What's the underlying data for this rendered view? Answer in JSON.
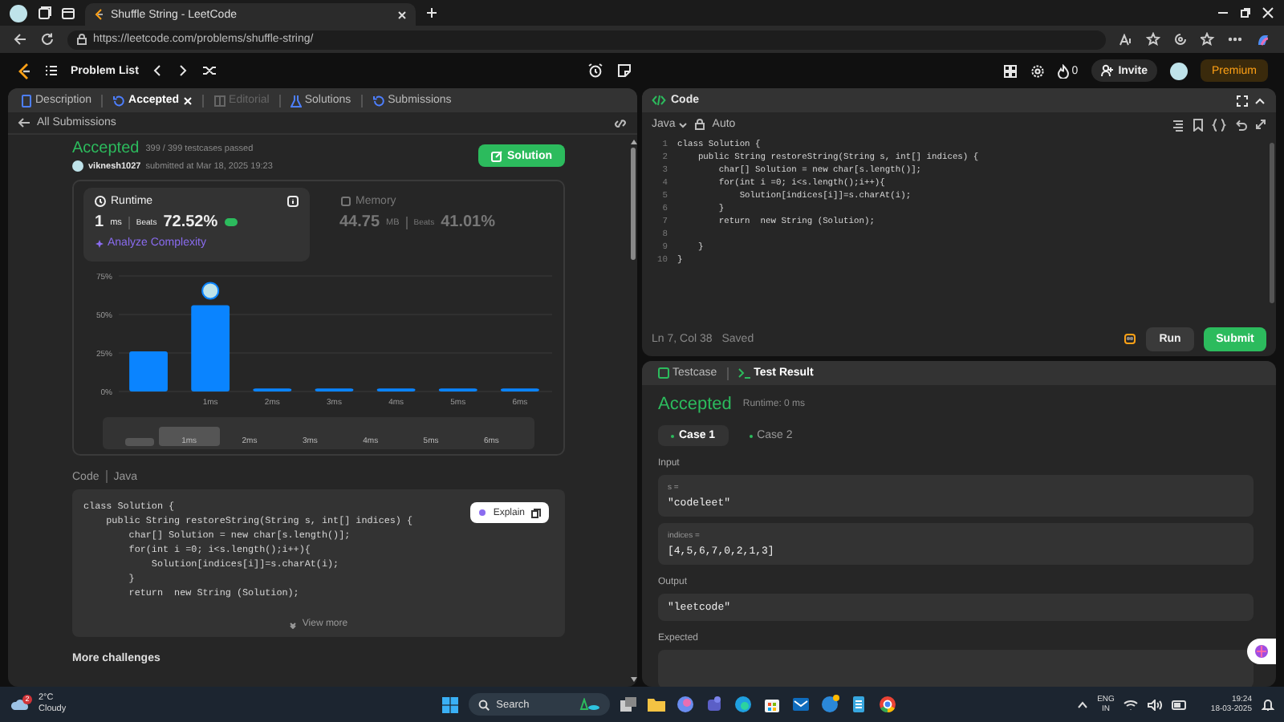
{
  "browser": {
    "tab_title": "Shuffle String - LeetCode",
    "url": "https://leetcode.com/problems/shuffle-string/"
  },
  "navbar": {
    "problem_list": "Problem List",
    "streak": "0",
    "invite": "Invite",
    "premium": "Premium"
  },
  "left_tabs": [
    {
      "label": "Description",
      "selected": false,
      "disabled": false
    },
    {
      "label": "Accepted",
      "selected": true,
      "disabled": false
    },
    {
      "label": "Editorial",
      "selected": false,
      "disabled": true
    },
    {
      "label": "Solutions",
      "selected": false,
      "disabled": false
    },
    {
      "label": "Submissions",
      "selected": false,
      "disabled": false
    }
  ],
  "submission": {
    "back": "All Submissions",
    "status": "Accepted",
    "passed": "399 / 399 testcases passed",
    "user": "viknesh1027",
    "submitted": "submitted at Mar 18, 2025 19:23",
    "solution_button": "Solution",
    "stats": [
      {
        "kind": "runtime",
        "title": "Runtime",
        "value": "1",
        "unit": "ms",
        "beats_label": "Beats",
        "beats": "72.52%",
        "link": "Analyze Complexity",
        "selected": true
      },
      {
        "kind": "memory",
        "title": "Memory",
        "value": "44.75",
        "unit": "MB",
        "beats_label": "Beats",
        "beats": "41.01%",
        "selected": false
      }
    ],
    "chart_data": {
      "type": "bar",
      "categories": [
        null,
        "1ms",
        "2ms",
        "3ms",
        "4ms",
        "5ms",
        "6ms"
      ],
      "values": [
        26,
        56,
        2,
        2,
        2,
        2,
        2
      ],
      "ylim": [
        0,
        75
      ],
      "yticks": [
        {
          "value": 0,
          "label": "0%"
        },
        {
          "value": 25,
          "label": "25%"
        },
        {
          "value": 50,
          "label": "50%"
        },
        {
          "value": 75,
          "label": "75%"
        }
      ]
    },
    "overview_labels": [
      "1ms",
      "2ms",
      "3ms",
      "4ms",
      "5ms",
      "6ms"
    ],
    "code_label": "Code",
    "code_language": "Java",
    "code_lines": [
      "class Solution {",
      "    public String restoreString(String s, int[] indices) {",
      "        char[] Solution = new char[s.length()];",
      "        for(int i =0; i<s.length();i++){",
      "            Solution[indices[i]]=s.charAt(i);",
      "        }",
      "        return  new String (Solution);"
    ],
    "explain": "Explain",
    "view_more": "View more",
    "more_challenges": "More challenges"
  },
  "editor": {
    "title": "Code",
    "language": "Java",
    "mode": "Auto",
    "lines": [
      {
        "n": "1",
        "code": "class Solution {"
      },
      {
        "n": "2",
        "code": "    public String restoreString(String s, int[] indices) {"
      },
      {
        "n": "3",
        "code": "        char[] Solution = new char[s.length()];"
      },
      {
        "n": "4",
        "code": "        for(int i =0; i<s.length();i++){"
      },
      {
        "n": "5",
        "code": "            Solution[indices[i]]=s.charAt(i);"
      },
      {
        "n": "6",
        "code": "        }"
      },
      {
        "n": "7",
        "code": "        return  new String (Solution);"
      },
      {
        "n": "8"
      },
      {
        "n": "9",
        "code": "    }"
      },
      {
        "n": "10",
        "code": "}"
      }
    ],
    "cursor": "Ln 7, Col 38",
    "saved": "Saved",
    "run": "Run",
    "submit": "Submit"
  },
  "result": {
    "tabs": [
      {
        "label": "Testcase",
        "selected": false
      },
      {
        "label": "Test Result",
        "selected": true
      }
    ],
    "status": "Accepted",
    "runtime": "Runtime: 0 ms",
    "cases": [
      {
        "label": "Case 1",
        "selected": true
      },
      {
        "label": "Case 2",
        "selected": false
      }
    ],
    "input_label": "Input",
    "inputs": [
      {
        "name": "s =",
        "value": "\"codeleet\""
      },
      {
        "name": "indices =",
        "value": "[4,5,6,7,0,2,1,3]"
      }
    ],
    "output_label": "Output",
    "output": "\"leetcode\"",
    "expected_label": "Expected"
  },
  "taskbar": {
    "weather_badge": "2",
    "temperature": "2°C",
    "weather": "Cloudy",
    "search": "Search",
    "language": "ENG",
    "region": "IN",
    "time": "19:24",
    "date": "18-03-2025"
  }
}
